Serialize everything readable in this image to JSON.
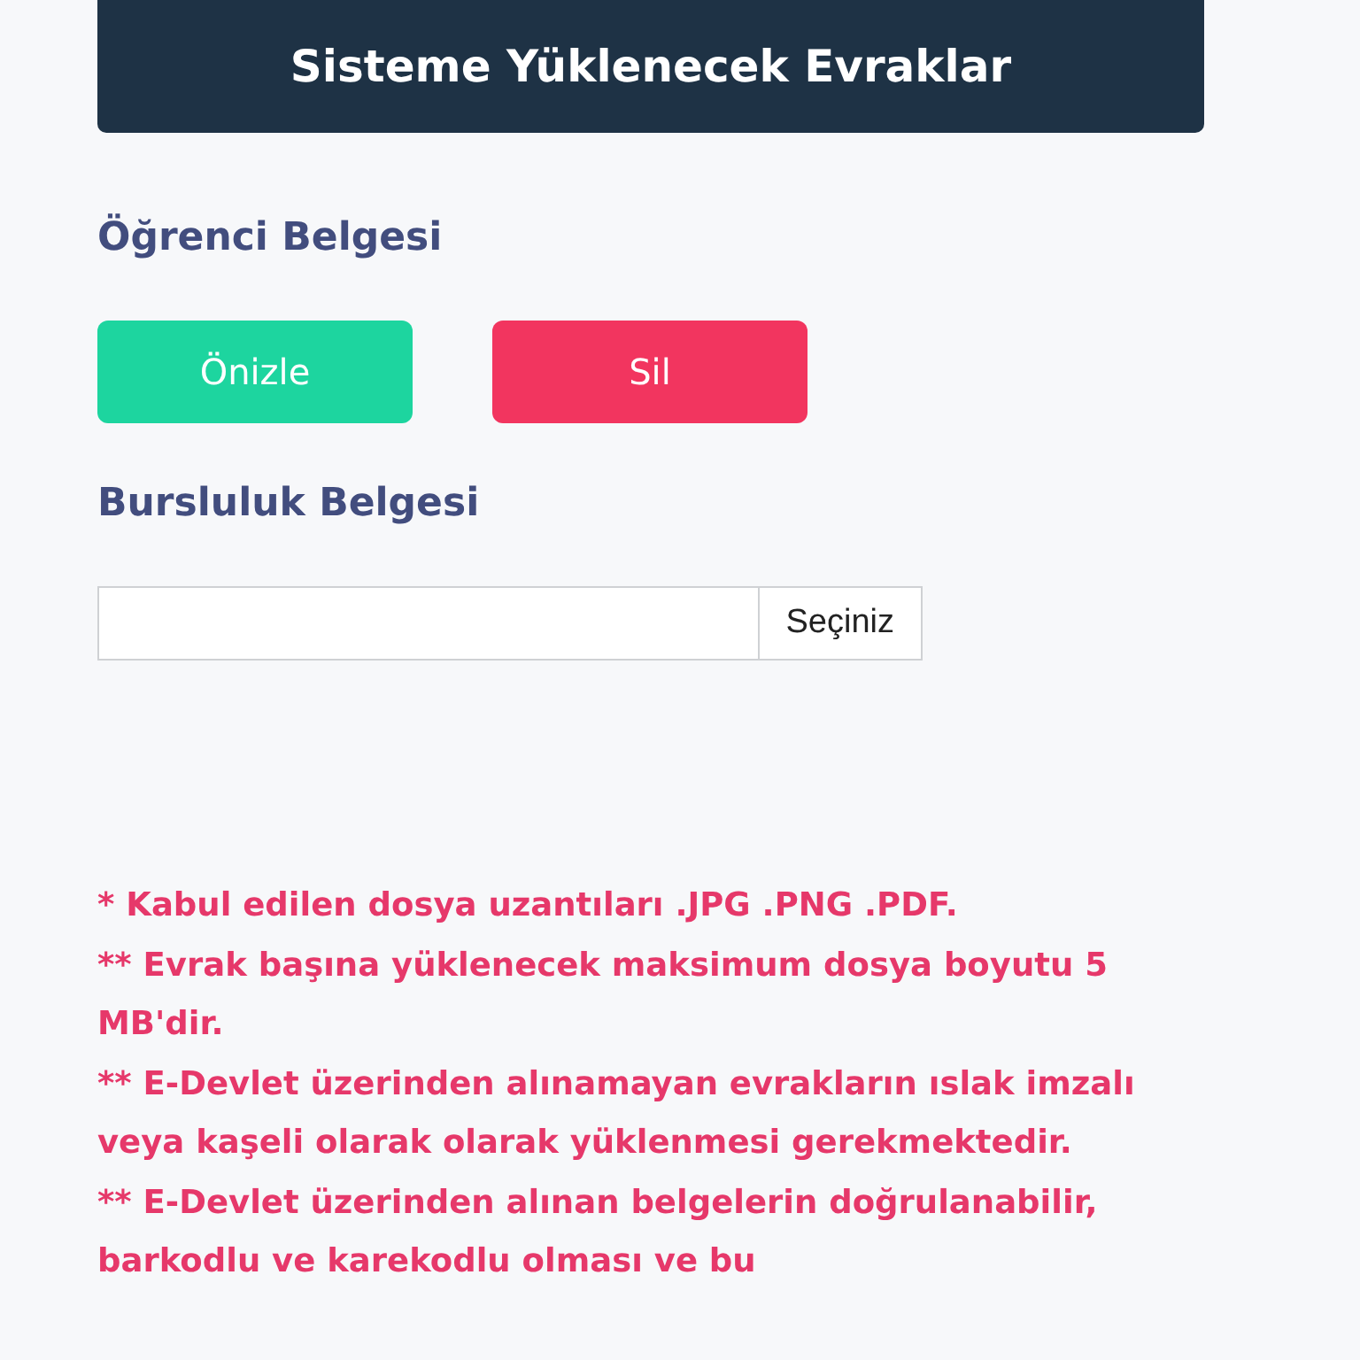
{
  "header": {
    "title": "Sisteme Yüklenecek Evraklar"
  },
  "documents": [
    {
      "kind": "uploaded",
      "title": "Öğrenci Belgesi",
      "actions": [
        {
          "kind": "preview",
          "label": "Önizle"
        },
        {
          "kind": "delete",
          "label": "Sil"
        }
      ]
    },
    {
      "kind": "file",
      "title": "Bursluluk Belgesi",
      "button": "Seçiniz"
    }
  ],
  "notes": [
    "* Kabul edilen dosya uzantıları .JPG .PNG .PDF.",
    "** Evrak başına yüklenecek maksimum dosya boyutu 5 MB'dir.",
    "** E-Devlet üzerinden alınamayan evrakların ıslak imzalı veya kaşeli olarak olarak yüklenmesi gerekmektedir.",
    "** E-Devlet üzerinden alınan belgelerin doğrulanabilir, barkodlu ve karekodlu olması ve bu"
  ]
}
